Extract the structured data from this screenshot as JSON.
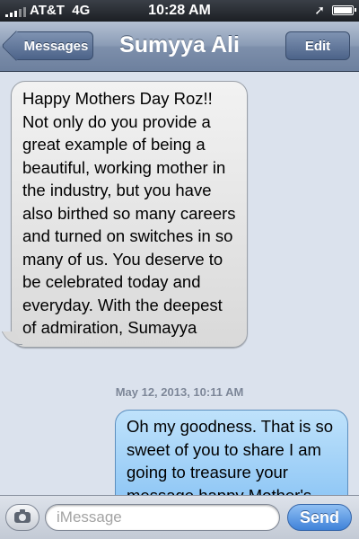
{
  "status_bar": {
    "carrier": "AT&T",
    "network": "4G",
    "time": "10:28 AM",
    "location_icon": "location-arrow-icon",
    "battery_icon": "battery-full-icon",
    "signal_icon": "signal-bars-icon"
  },
  "nav": {
    "back_label": "Messages",
    "title": "Sumyya Ali",
    "edit_label": "Edit"
  },
  "conversation": {
    "messages": [
      {
        "direction": "received",
        "text": "Happy Mothers Day Roz!! Not only do you provide a great example of being a beautiful, working mother in the industry, but you have also birthed so many careers and turned on switches in so many of us. You deserve to be celebrated today and everyday. With the deepest of admiration, Sumayya"
      },
      {
        "direction": "sent",
        "text": "Oh my goodness. That is so sweet of you to share I am going to treasure your message happy Mother's"
      }
    ],
    "timestamp": "May 12, 2013, 10:11 AM"
  },
  "input_bar": {
    "camera_icon": "camera-icon",
    "placeholder": "iMessage",
    "value": "",
    "send_label": "Send"
  },
  "colors": {
    "nav_bar": "#8b9cb6",
    "received_bubble": "#e5e5e5",
    "sent_bubble": "#9fd0f8",
    "send_button": "#3f82d9",
    "background": "#dbe2ed"
  }
}
